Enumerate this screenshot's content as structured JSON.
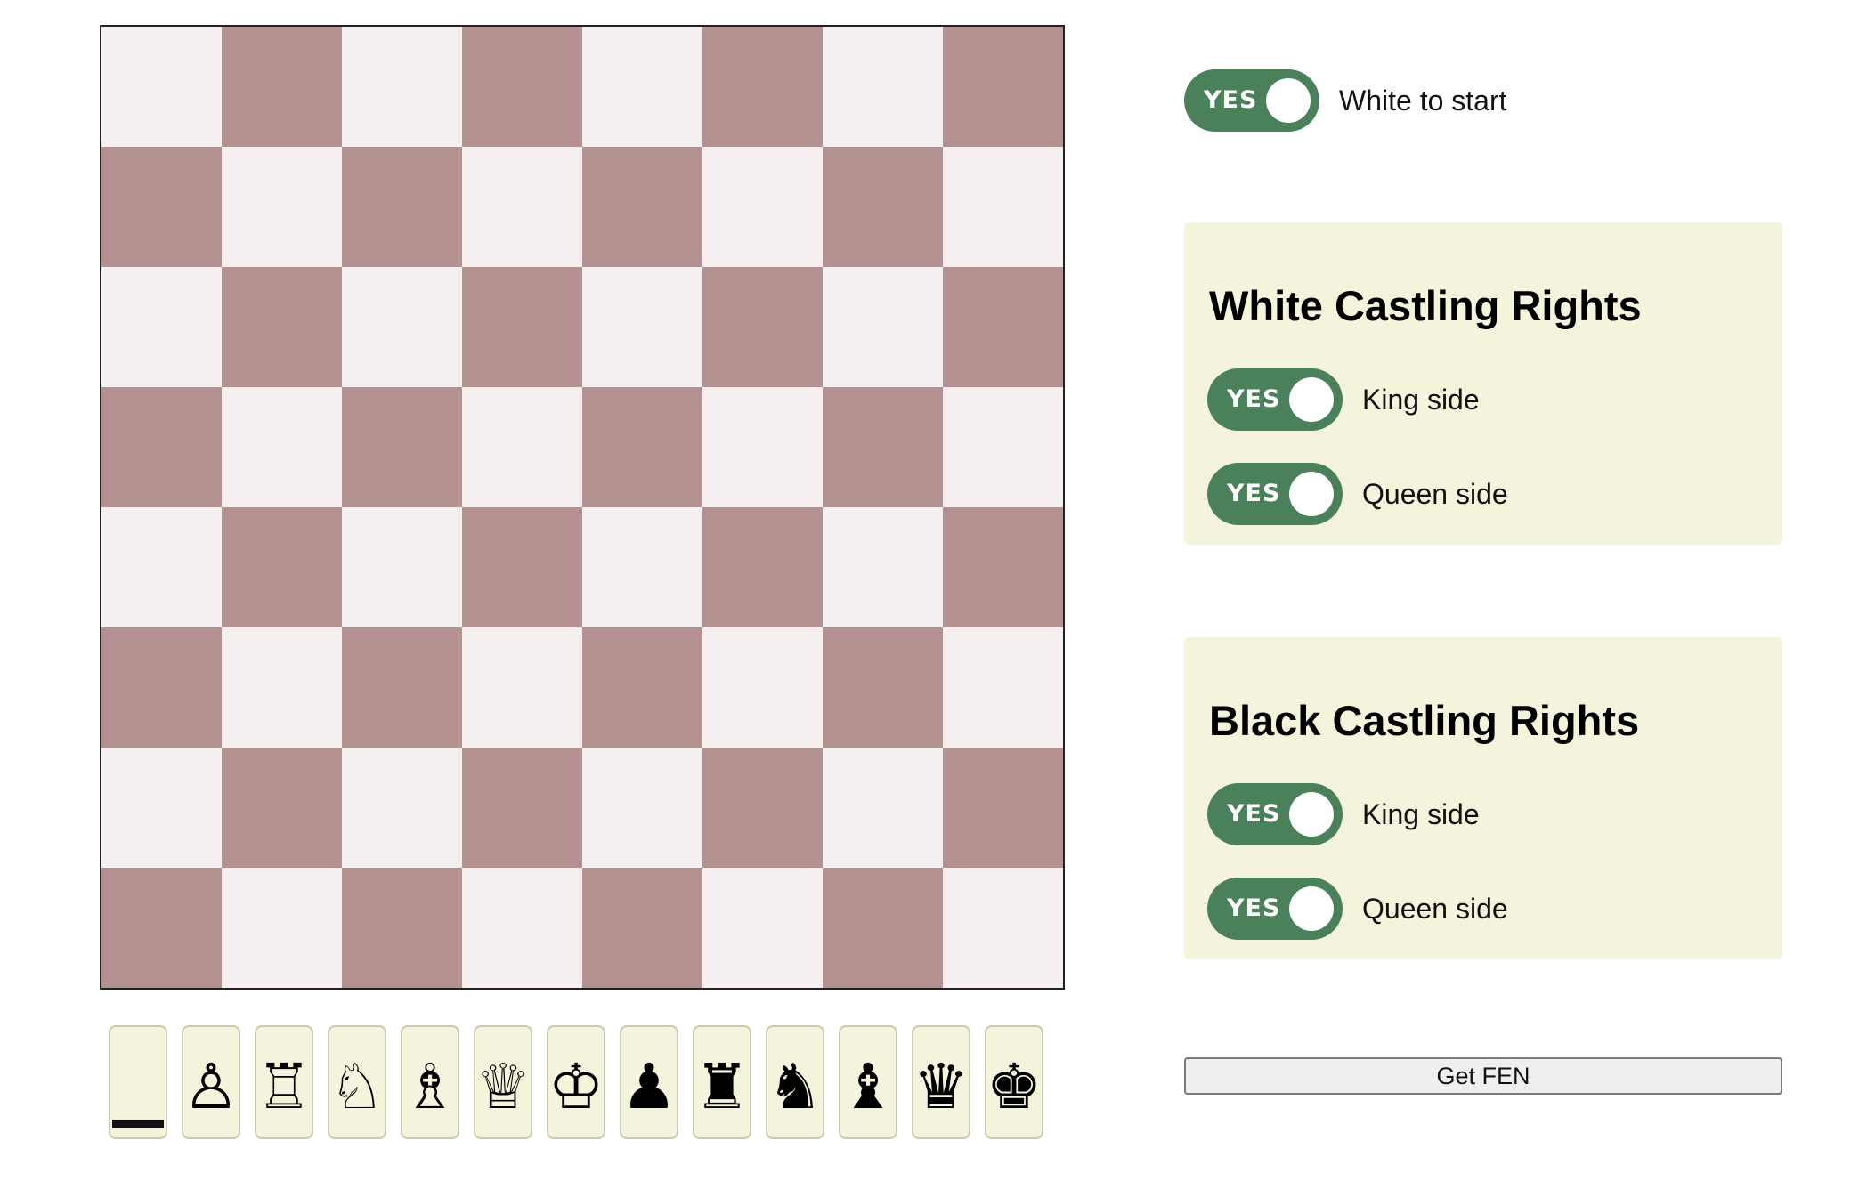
{
  "board": {
    "light_color": "#f6eff0",
    "dark_color": "#b39190"
  },
  "palette": [
    {
      "name": "eraser",
      "glyph": ""
    },
    {
      "name": "white-pawn",
      "glyph": "♙"
    },
    {
      "name": "white-rook",
      "glyph": "♖"
    },
    {
      "name": "white-knight",
      "glyph": "♘"
    },
    {
      "name": "white-bishop",
      "glyph": "♗"
    },
    {
      "name": "white-queen",
      "glyph": "♕"
    },
    {
      "name": "white-king",
      "glyph": "♔"
    },
    {
      "name": "black-pawn",
      "glyph": "♟"
    },
    {
      "name": "black-rook",
      "glyph": "♜"
    },
    {
      "name": "black-knight",
      "glyph": "♞"
    },
    {
      "name": "black-bishop",
      "glyph": "♝"
    },
    {
      "name": "black-queen",
      "glyph": "♛"
    },
    {
      "name": "black-king",
      "glyph": "♚"
    }
  ],
  "turn": {
    "toggle_text": "YES",
    "label": "White to start",
    "on": true
  },
  "white_castling": {
    "title": "White Castling Rights",
    "king_side": {
      "toggle_text": "YES",
      "label": "King side",
      "on": true
    },
    "queen_side": {
      "toggle_text": "YES",
      "label": "Queen side",
      "on": true
    }
  },
  "black_castling": {
    "title": "Black Castling Rights",
    "king_side": {
      "toggle_text": "YES",
      "label": "King side",
      "on": true
    },
    "queen_side": {
      "toggle_text": "YES",
      "label": "Queen side",
      "on": true
    }
  },
  "get_fen_label": "Get FEN",
  "colors": {
    "toggle_on": "#4a815a",
    "panel_bg": "#f4f4dc"
  }
}
